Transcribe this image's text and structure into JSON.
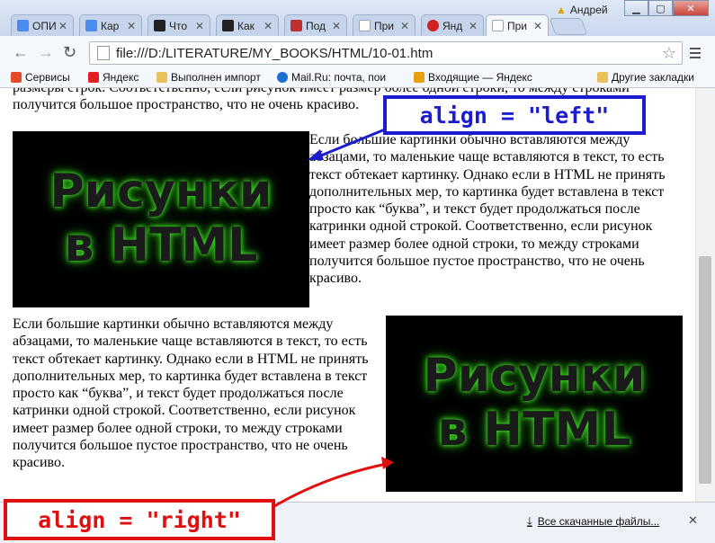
{
  "browser": {
    "user_name": "Андрей",
    "tabs": [
      {
        "label": "ОПИ",
        "color": "#4a8df0"
      },
      {
        "label": "Кар",
        "color": "#4a8df0"
      },
      {
        "label": "Что",
        "color": "#222222"
      },
      {
        "label": "Как",
        "color": "#222222"
      },
      {
        "label": "Под",
        "color": "#c03030"
      },
      {
        "label": "При",
        "color": "#9aa5b5"
      },
      {
        "label": "Янд",
        "color": "#d02020"
      },
      {
        "label": "При",
        "color": "#9aa5b5"
      }
    ],
    "url": "file:///D:/LITERATURE/MY_BOOKS/HTML/10-01.htm",
    "bookmarks": [
      {
        "label": "Сервисы",
        "color": "#e34c26"
      },
      {
        "label": "Яндекс",
        "color": "#e02020"
      },
      {
        "label": "Выполнен импорт",
        "color": "#e8c15a"
      },
      {
        "label": "Mail.Ru: почта, пои",
        "color": "#1b6fd1"
      },
      {
        "label": "Входящие — Яндекс",
        "color": "#e8a010"
      },
      {
        "label": "Другие закладки",
        "color": "#e8c15a"
      }
    ],
    "downloads_label": "Все скачанные файлы..."
  },
  "page": {
    "top_partial_line": "размеры строк. Соответственно, если рисунок имеет размер более одной строки, то между строками получится большое",
    "top_line": "пространство, что не очень красиво.",
    "paragraph": "Если большие картинки обычно вставляются между абзацами, то маленькие чаще вставляются в текст, то есть текст обтекает картинку. Однако если в HTML не принять дополнительных мер, то картинка будет вставлена в текст просто как “буква”, и текст будет продолжаться после катринки одной строкой. Соответственно, если рисунок имеет размер более одной строки, то между строками получится большое пустое пространство, что не очень красиво.",
    "image_text_line1": "Рисунки",
    "image_text_line2": "в HTML"
  },
  "annotations": {
    "left_label": "align = \"left\"",
    "right_label": "align = \"right\"",
    "left_color": "#1c1ccf",
    "right_color": "#e01010"
  }
}
